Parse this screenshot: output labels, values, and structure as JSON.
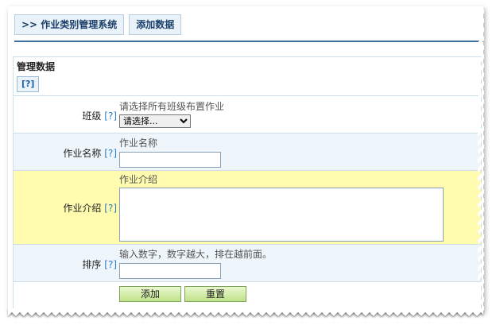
{
  "nav": {
    "tab1": ">> 作业类别管理系统",
    "tab2": "添加数据"
  },
  "panel": {
    "title": "管理数据",
    "help": "[?]"
  },
  "form": {
    "class": {
      "label": "班级",
      "help": "[?]",
      "tip": "请选择所有班级布置作业",
      "selected": "请选择..."
    },
    "name": {
      "label": "作业名称",
      "help": "[?]",
      "tip": "作业名称",
      "value": ""
    },
    "intro": {
      "label": "作业介绍",
      "help": "[?]",
      "tip": "作业介绍",
      "value": ""
    },
    "order": {
      "label": "排序",
      "help": "[?]",
      "tip": "输入数字，数字越大，排在越前面。",
      "value": ""
    }
  },
  "buttons": {
    "submit": "添加",
    "reset": "重置"
  }
}
